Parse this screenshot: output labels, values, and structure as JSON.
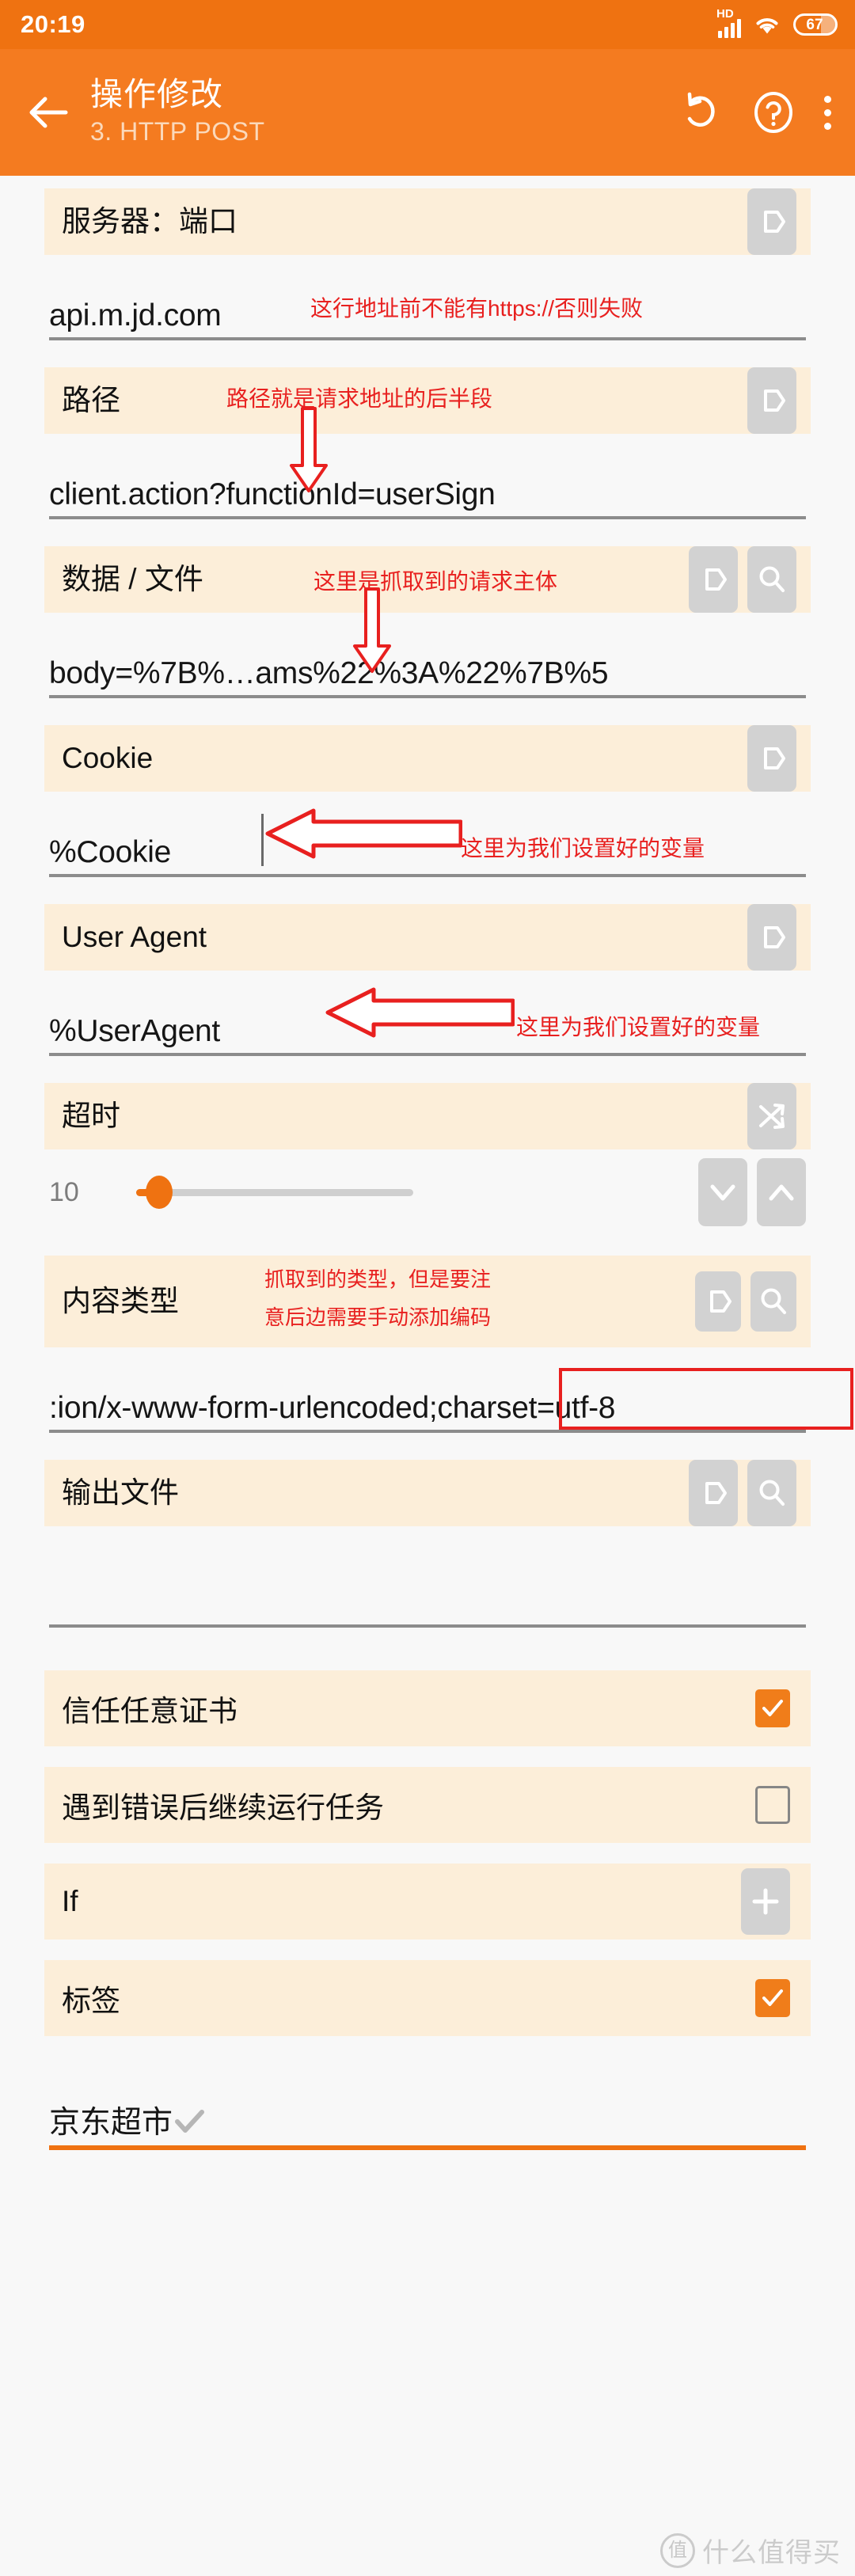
{
  "status_bar": {
    "clock": "20:19",
    "network_label": "HD",
    "signal_icon": "cellular-signal-icon",
    "wifi_icon": "wifi-icon",
    "battery_percent": "67"
  },
  "app_bar": {
    "back_icon": "back-arrow-icon",
    "title": "操作修改",
    "subtitle": "3. HTTP POST",
    "undo_icon": "undo-icon",
    "help_icon": "help-icon",
    "overflow_icon": "overflow-menu-icon"
  },
  "colors": {
    "accent_orange": "#f47b20",
    "status_orange": "#ef7211",
    "section_bg": "#fceed9",
    "page_bg": "#f8f8f8",
    "annotation_red": "#e8201f",
    "button_gray": "#d2d2d2"
  },
  "fields": {
    "server_port": {
      "label": "服务器：端口",
      "value": "api.m.jd.com",
      "variable_icon": "variable-tag-icon",
      "annotation": "这行地址前不能有https://否则失败"
    },
    "path": {
      "label": "路径",
      "value": "client.action?functionId=userSign",
      "variable_icon": "variable-tag-icon",
      "annotation": "路径就是请求地址的后半段"
    },
    "data_file": {
      "label": "数据 / 文件",
      "value": "body=%7B%…ams%22%3A%22%7B%5",
      "variable_icon": "variable-tag-icon",
      "search_icon": "search-icon",
      "annotation": "这里是抓取到的请求主体"
    },
    "cookie": {
      "label": "Cookie",
      "value": "%Cookie",
      "variable_icon": "variable-tag-icon",
      "annotation": "这里为我们设置好的变量"
    },
    "user_agent": {
      "label": "User Agent",
      "value": "%UserAgent",
      "variable_icon": "variable-tag-icon",
      "annotation": "这里为我们设置好的变量"
    },
    "timeout": {
      "label": "超时",
      "shuffle_icon": "shuffle-variable-icon",
      "value": "10",
      "decrease_icon": "chevron-down-icon",
      "increase_icon": "chevron-up-icon"
    },
    "content_type": {
      "label": "内容类型",
      "value": ":ion/x-www-form-urlencoded;charset=utf-8",
      "highlighted_part": ";charset=utf-8",
      "variable_icon": "variable-tag-icon",
      "search_icon": "search-icon",
      "annotation_line1": "抓取到的类型，但是要注",
      "annotation_line2": "意后边需要手动添加编码"
    },
    "output_file": {
      "label": "输出文件",
      "value": "",
      "variable_icon": "variable-tag-icon",
      "search_icon": "search-icon"
    }
  },
  "toggles": [
    {
      "label": "信任任意证书",
      "checked": true
    },
    {
      "label": "遇到错误后继续运行任务",
      "checked": false
    }
  ],
  "if_row": {
    "label": "If",
    "add_icon": "plus-icon"
  },
  "tag_row": {
    "label": "标签",
    "checked": true,
    "tag_value": "京东超市",
    "tag_check_icon": "check-icon"
  },
  "watermark": {
    "badge": "值",
    "text": "什么值得买"
  }
}
